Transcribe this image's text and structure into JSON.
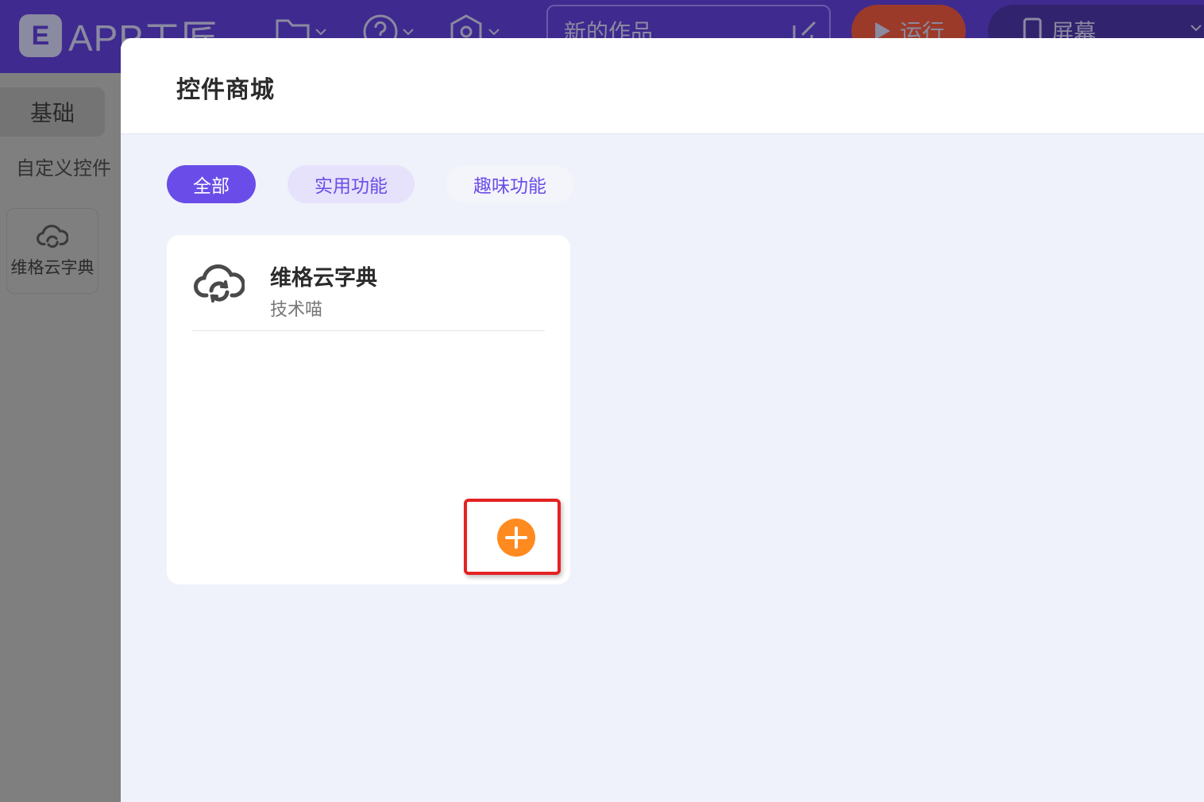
{
  "app": {
    "logo_mark": "E",
    "logo_text": "APP工匠",
    "project_title": "新的作品",
    "run_label": "运行",
    "screen_label": "屏幕"
  },
  "toolbar": {
    "icons": [
      "folder-icon",
      "help-icon",
      "settings-icon"
    ]
  },
  "left_panel": {
    "tab_label": "基础",
    "section_label": "自定义控件",
    "items": [
      {
        "label": "维格云字典",
        "icon": "cloud-sync-icon"
      }
    ]
  },
  "modal": {
    "title": "控件商城",
    "filters": [
      {
        "label": "全部",
        "selected": true
      },
      {
        "label": "实用功能",
        "selected": false
      },
      {
        "label": "趣味功能",
        "selected": false
      }
    ],
    "cards": [
      {
        "name": "维格云字典",
        "author": "技术喵",
        "icon": "cloud-sync-icon"
      }
    ]
  },
  "colors": {
    "accent": "#6a4de8",
    "add_button": "#ff8a1f",
    "highlight": "#e52222",
    "topbar": "#3f2a8f"
  }
}
